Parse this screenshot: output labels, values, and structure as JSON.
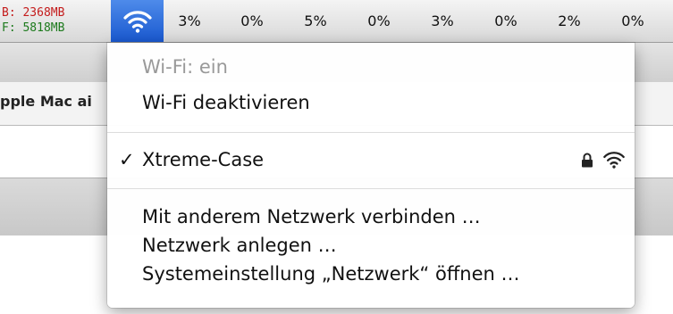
{
  "menubar": {
    "memory": {
      "busy": "B: 2368MB",
      "free": "F: 5818MB"
    },
    "cpu": [
      "3%",
      "0%",
      "5%",
      "0%",
      "3%",
      "0%",
      "2%",
      "0%"
    ]
  },
  "background": {
    "tab_label": "pple Mac ai"
  },
  "menu": {
    "status": "Wi-Fi: ein",
    "toggle": "Wi-Fi deaktivieren",
    "network": {
      "check": "✓",
      "name": "Xtreme-Case"
    },
    "join_other": "Mit anderem Netzwerk verbinden …",
    "create": "Netzwerk anlegen …",
    "prefs": "Systemeinstellung „Netzwerk“ öffnen …"
  },
  "colors": {
    "accent": "#1f62d8",
    "busy": "#c41c1c",
    "free": "#1d7a1d"
  },
  "icons": {
    "menubar": "wifi-icon",
    "secure": "lock-icon",
    "signal": "wifi-icon"
  }
}
